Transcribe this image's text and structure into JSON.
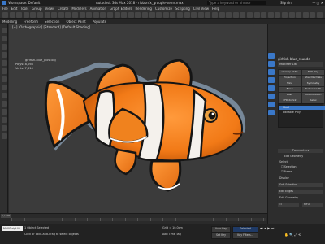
{
  "window": {
    "workspace": "Workspace: Default",
    "title": "Autodesk 3ds Max 2018 - ribbonfx_groupie-seins.max",
    "search_placeholder": "Type a keyword or phrase",
    "user": "Sign In"
  },
  "menu": [
    "File",
    "Edit",
    "Tools",
    "Group",
    "Views",
    "Create",
    "Modifiers",
    "Animation",
    "Graph Editors",
    "Rendering",
    "Customize",
    "Scripting",
    "Civil View",
    "Help"
  ],
  "ribbon": [
    "Modeling",
    "Freeform",
    "Selection",
    "Object Paint",
    "Populate"
  ],
  "viewport": {
    "label": "[+] [Orthographic] [Standard] [Default Shading]",
    "stats": {
      "name_label": "girlfish-blue_glow.obj",
      "polys_label": "Polys:",
      "polys_value": "8,066",
      "verts_label": "Verts:",
      "verts_value": "7,614"
    }
  },
  "command_panel": {
    "object_name": "girlfish-blue_rounde",
    "modifier_list": "Modifier List",
    "buttons": [
      [
        "Unwrap UVW",
        "Edit Poly"
      ],
      [
        "Projection",
        "Shell Normals"
      ],
      [
        "Slice",
        "Symmetry"
      ],
      [
        "Bend",
        "Turbosmooth"
      ],
      [
        "Push",
        "TurboSmooth"
      ],
      [
        "FFD 2x2x2",
        "Relax"
      ]
    ],
    "stack": [
      "Shell",
      "Editable Poly"
    ],
    "parameters_title": "Parameters",
    "edit_geometry": "Edit Geometry",
    "select_label": "Select",
    "checks": [
      "Selection",
      "Frame"
    ],
    "display_label": "Display",
    "sub_rows": [
      "Soft Selection",
      "Edit Edges"
    ],
    "edge_label": "Edit Geometry",
    "fifo": [
      "Ti",
      "FIFO"
    ]
  },
  "timeline": {
    "frame": "0 / 100"
  },
  "status": {
    "maxscript": "MAXScript Mi",
    "selected": "1 Object Selected",
    "hint": "Click or click-and-drag to select objects",
    "grid": "Grid = 10.0cm",
    "add_time_tag": "Add Time Tag",
    "auto_key": "Auto Key",
    "set_key": "Set Key",
    "selected_filter": "Selected",
    "key_filters": "Key Filters..."
  },
  "colors": {
    "accent": "#3a78c9",
    "fish_orange": "#f27a17",
    "fish_white": "#f4f1ec",
    "fish_black": "#151515",
    "viewport_bg": "#3b3b3b"
  }
}
